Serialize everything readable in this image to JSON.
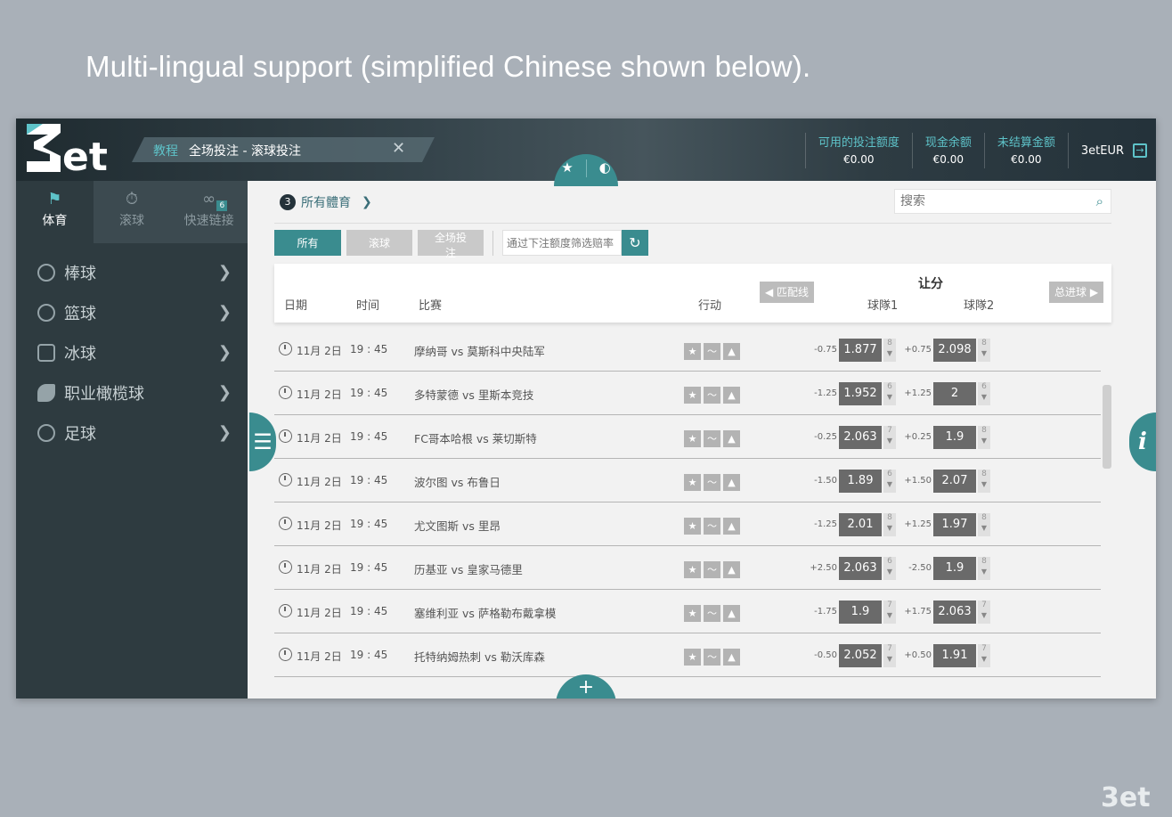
{
  "caption": "Multi-lingual support (simplified Chinese shown below).",
  "header": {
    "logo_text": "3et",
    "tutorial_label": "教程",
    "tutorial_text": "全场投注 - 滚球投注",
    "close_glyph": "✕",
    "favorites_glyph": "★",
    "chart_glyph": "◐",
    "balances": [
      {
        "label": "可用的投注额度",
        "value": "€0.00"
      },
      {
        "label": "现金余额",
        "value": "€0.00"
      },
      {
        "label": "未结算金额",
        "value": "€0.00"
      }
    ],
    "username": "3etEUR"
  },
  "sidebar": {
    "tabs": [
      {
        "label": "体育",
        "icon": "flag-icon"
      },
      {
        "label": "滚球",
        "icon": "stopwatch-icon"
      },
      {
        "label": "快速链接",
        "icon": "link-icon",
        "badge": "6"
      }
    ],
    "items": [
      {
        "label": "棒球",
        "icon": "baseball-icon"
      },
      {
        "label": "篮球",
        "icon": "basketball-icon"
      },
      {
        "label": "冰球",
        "icon": "hockey-icon"
      },
      {
        "label": "职业橄榄球",
        "icon": "football-icon"
      },
      {
        "label": "足球",
        "icon": "soccer-icon"
      }
    ]
  },
  "main": {
    "breadcrumb": "所有體育",
    "search_placeholder": "搜索",
    "filters": {
      "all": "所有",
      "live": "滚球",
      "fulltime": "全场投注",
      "amount_placeholder": "通过下注额度筛选赔率"
    },
    "table": {
      "col_date": "日期",
      "col_time": "时间",
      "col_match": "比赛",
      "col_action": "行动",
      "group_title": "让分",
      "prev_market": "匹配线",
      "next_market": "总进球",
      "col_team1": "球隊1",
      "col_team2": "球隊2",
      "rows": [
        {
          "date": "11月 2日",
          "time": "19 : 45",
          "match": "摩纳哥 vs 莫斯科中央陆军",
          "h1": "-0.75",
          "o1": "1.877",
          "c1": "8",
          "h2": "+0.75",
          "o2": "2.098",
          "c2": "8"
        },
        {
          "date": "11月 2日",
          "time": "19 : 45",
          "match": "多特蒙德 vs 里斯本竞技",
          "h1": "-1.25",
          "o1": "1.952",
          "c1": "6",
          "h2": "+1.25",
          "o2": "2",
          "c2": "6"
        },
        {
          "date": "11月 2日",
          "time": "19 : 45",
          "match": "FC哥本哈根 vs 莱切斯特",
          "h1": "-0.25",
          "o1": "2.063",
          "c1": "7",
          "h2": "+0.25",
          "o2": "1.9",
          "c2": "8"
        },
        {
          "date": "11月 2日",
          "time": "19 : 45",
          "match": "波尔图 vs 布鲁日",
          "h1": "-1.50",
          "o1": "1.89",
          "c1": "6",
          "h2": "+1.50",
          "o2": "2.07",
          "c2": "8"
        },
        {
          "date": "11月 2日",
          "time": "19 : 45",
          "match": "尤文图斯 vs 里昂",
          "h1": "-1.25",
          "o1": "2.01",
          "c1": "8",
          "h2": "+1.25",
          "o2": "1.97",
          "c2": "8"
        },
        {
          "date": "11月 2日",
          "time": "19 : 45",
          "match": "历基亚 vs 皇家马德里",
          "h1": "+2.50",
          "o1": "2.063",
          "c1": "6",
          "h2": "-2.50",
          "o2": "1.9",
          "c2": "8"
        },
        {
          "date": "11月 2日",
          "time": "19 : 45",
          "match": "塞维利亚 vs 萨格勒布戴拿模",
          "h1": "-1.75",
          "o1": "1.9",
          "c1": "7",
          "h2": "+1.75",
          "o2": "2.063",
          "c2": "7"
        },
        {
          "date": "11月 2日",
          "time": "19 : 45",
          "match": "托特纳姆热刺 vs 勒沃库森",
          "h1": "-0.50",
          "o1": "2.052",
          "c1": "7",
          "h2": "+0.50",
          "o2": "1.91",
          "c2": "7"
        }
      ]
    }
  },
  "colors": {
    "accent": "#3a8c8f",
    "sidebar": "#2e3b40",
    "teal_text": "#5ec3c9"
  }
}
